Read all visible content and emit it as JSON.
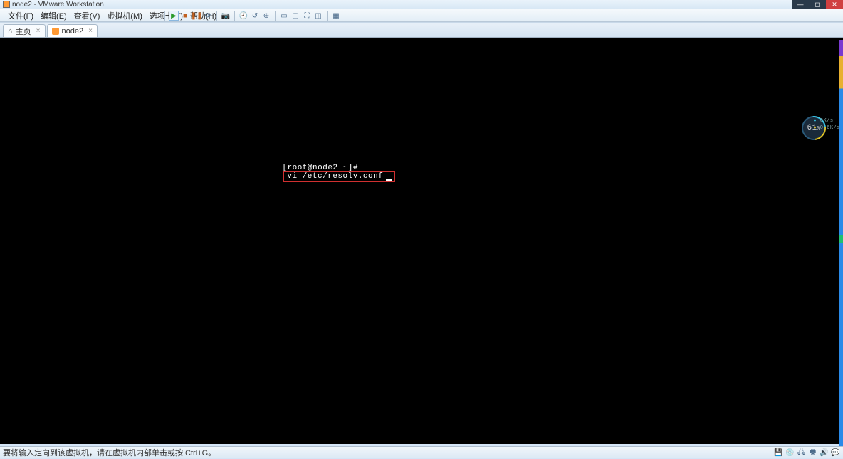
{
  "window": {
    "title": "node2 - VMware Workstation"
  },
  "menu": {
    "file": "文件(F)",
    "edit": "编辑(E)",
    "view": "查看(V)",
    "vm": "虚拟机(M)",
    "tabs": "选项卡(T)",
    "help": "帮助(H)"
  },
  "tabs": {
    "home": "主页",
    "node2": "node2"
  },
  "terminal": {
    "prompt": "[root@node2 ~]#",
    "command": "vi /etc/resolv.conf"
  },
  "gauge": {
    "value": "61",
    "unit": "%",
    "net_up": "0K/s",
    "net_down": "0.6K/s"
  },
  "statusbar": {
    "message": "要将输入定向到该虚拟机，请在虚拟机内部单击或按 Ctrl+G。"
  }
}
